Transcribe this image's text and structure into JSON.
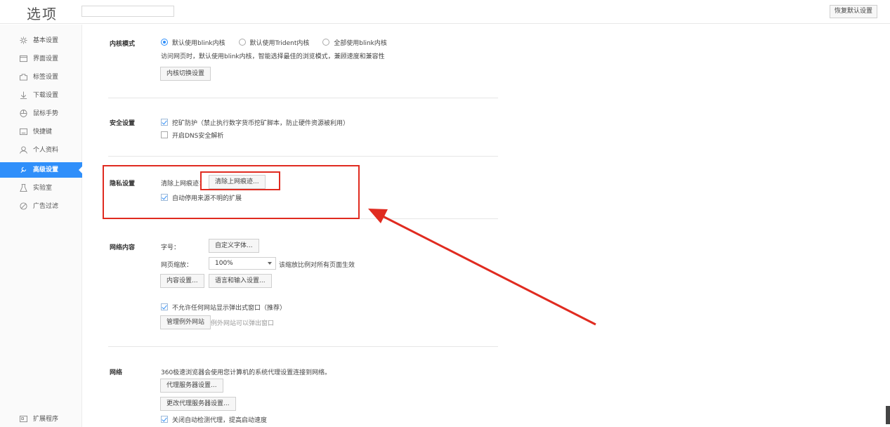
{
  "header": {
    "title": "选项",
    "search_placeholder": "",
    "restore_label": "恢复默认设置"
  },
  "sidebar": {
    "items": [
      {
        "label": "基本设置",
        "icon": "gear-icon"
      },
      {
        "label": "界面设置",
        "icon": "window-icon"
      },
      {
        "label": "标签设置",
        "icon": "tab-icon"
      },
      {
        "label": "下载设置",
        "icon": "download-icon"
      },
      {
        "label": "鼠标手势",
        "icon": "mouse-icon"
      },
      {
        "label": "快捷键",
        "icon": "keyboard-icon"
      },
      {
        "label": "个人资料",
        "icon": "user-icon"
      },
      {
        "label": "高级设置",
        "icon": "advanced-icon",
        "active": true
      },
      {
        "label": "实验室",
        "icon": "lab-icon"
      },
      {
        "label": "广告过滤",
        "icon": "block-icon"
      }
    ],
    "extensions": {
      "label": "扩展程序",
      "icon": "extension-icon"
    }
  },
  "kernel": {
    "label": "内核模式",
    "options": [
      "默认使用blink内核",
      "默认使用Trident内核",
      "全部使用blink内核"
    ],
    "selected": 0,
    "desc": "访问网页时，默认使用blink内核，智能选择最佳的浏览模式，兼顾速度和兼容性",
    "switch_button": "内核切换设置"
  },
  "security": {
    "label": "安全设置",
    "options": [
      {
        "label": "挖矿防护（禁止执行数字货币挖矿脚本，防止硬件资源被利用）",
        "checked": true
      },
      {
        "label": "开启DNS安全解析",
        "checked": false
      }
    ]
  },
  "privacy": {
    "label": "隐私设置",
    "clear_label": "清除上网痕迹：",
    "clear_button": "清除上网痕迹...",
    "auto_disable": {
      "label": "自动停用来源不明的扩展",
      "checked": true
    }
  },
  "web_content": {
    "label": "网络内容",
    "font_size_label": "字号：",
    "custom_font_button": "自定义字体...",
    "zoom_label": "网页缩放：",
    "zoom_value": "100%",
    "zoom_hint": "该缩放比例对所有页面生效",
    "content_settings_button": "内容设置...",
    "language_button": "语言和输入设置...",
    "popup_block": {
      "label": "不允许任何网站显示弹出式窗口（推荐）",
      "checked": true
    },
    "manage_exceptions_button": "管理例外网站",
    "exceptions_hint": "例外网站可以弹出窗口"
  },
  "network": {
    "label": "网络",
    "desc": "360极速浏览器会使用您计算机的系统代理设置连接到网络。",
    "proxy_button": "代理服务器设置...",
    "change_proxy_button": "更改代理服务器设置...",
    "auto_detect": {
      "label": "关闭自动检测代理，提高启动速度",
      "checked": true
    }
  },
  "colors": {
    "accent": "#2f8ffa",
    "annotation": "#e02b20"
  }
}
